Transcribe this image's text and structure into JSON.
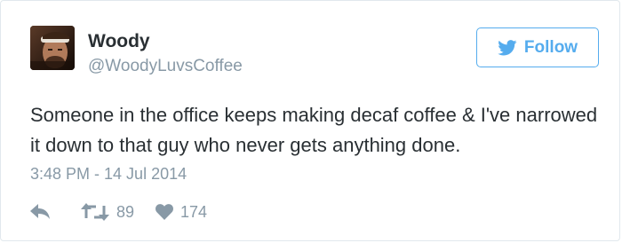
{
  "user": {
    "display_name": "Woody",
    "handle": "@WoodyLuvsCoffee"
  },
  "follow_button": {
    "label": "Follow",
    "icon": "twitter-bird-icon"
  },
  "tweet": {
    "text": "Someone in the office keeps making decaf coffee & I've narrowed it down to that guy who never gets anything done.",
    "timestamp": "3:48 PM - 14 Jul 2014"
  },
  "actions": {
    "reply_icon": "reply-arrow-icon",
    "retweet_icon": "retweet-icon",
    "retweet_count": "89",
    "like_icon": "heart-icon",
    "like_count": "174"
  },
  "colors": {
    "accent": "#55acee",
    "text": "#292f33",
    "muted": "#8899a6",
    "border": "#e1e8ed"
  }
}
